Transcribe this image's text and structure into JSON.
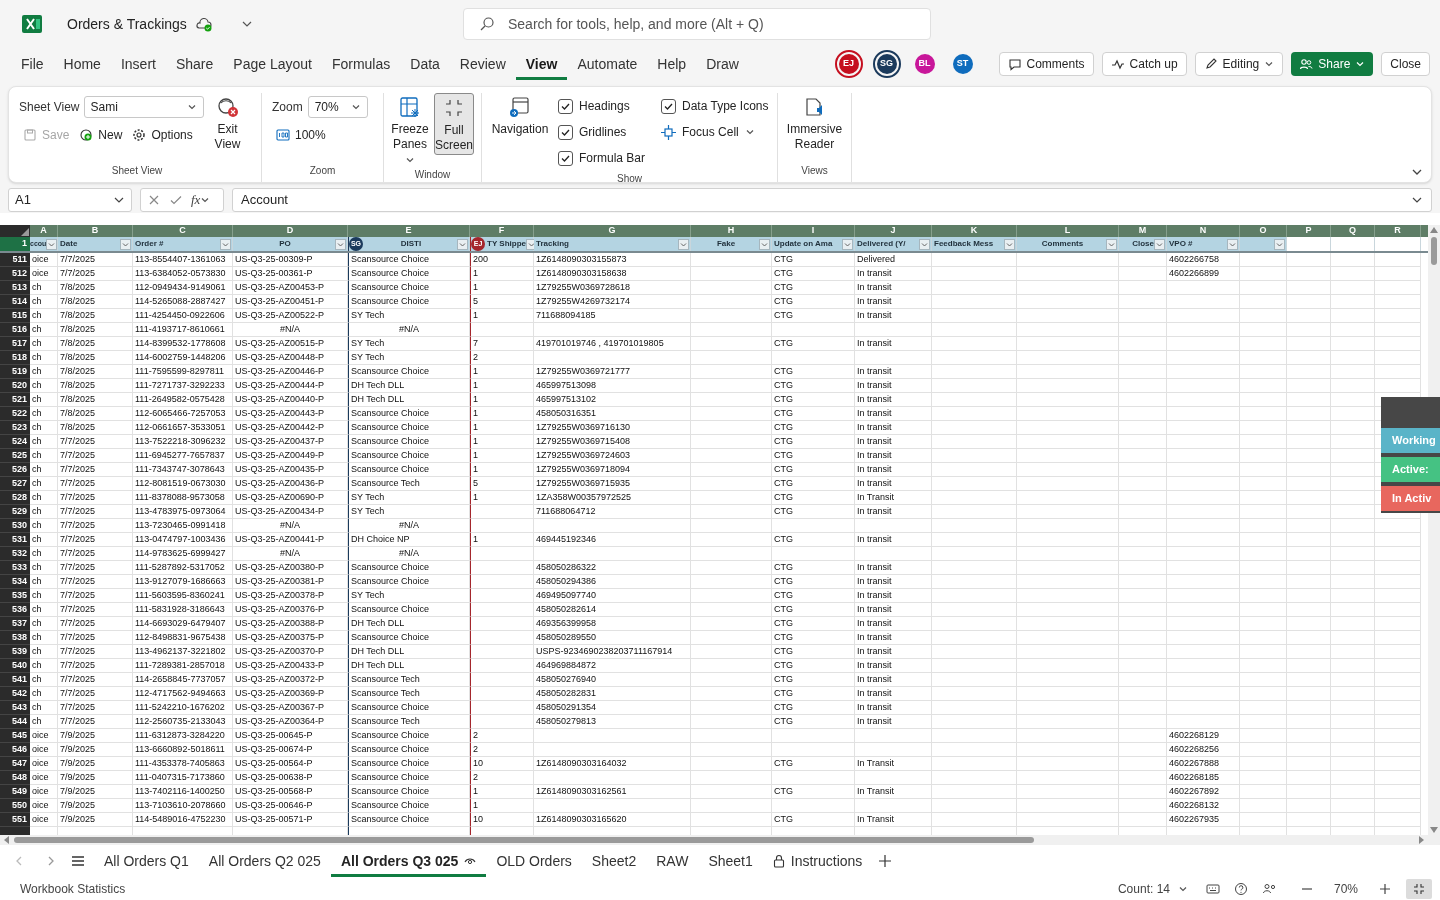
{
  "app": {
    "title": "Orders & Trackings",
    "search_placeholder": "Search for tools, help, and more (Alt + Q)"
  },
  "menu_tabs": [
    {
      "label": "File",
      "selected": false
    },
    {
      "label": "Home",
      "selected": false
    },
    {
      "label": "Insert",
      "selected": false
    },
    {
      "label": "Share",
      "selected": false
    },
    {
      "label": "Page Layout",
      "selected": false
    },
    {
      "label": "Formulas",
      "selected": false
    },
    {
      "label": "Data",
      "selected": false
    },
    {
      "label": "Review",
      "selected": false
    },
    {
      "label": "View",
      "selected": true
    },
    {
      "label": "Automate",
      "selected": false
    },
    {
      "label": "Help",
      "selected": false
    },
    {
      "label": "Draw",
      "selected": false
    }
  ],
  "collaborators": [
    {
      "initials": "EJ",
      "color": "#c50f1f",
      "active": true
    },
    {
      "initials": "SG",
      "color": "#1b3a5c",
      "active": true
    },
    {
      "initials": "BL",
      "color": "#c8179a",
      "active": false
    },
    {
      "initials": "ST",
      "color": "#0f6cbd",
      "active": false
    }
  ],
  "header_buttons": [
    {
      "label": "Comments",
      "kind": "comments"
    },
    {
      "label": "Catch up",
      "kind": "catch-up"
    },
    {
      "label": "Editing",
      "kind": "editing"
    },
    {
      "label": "Share",
      "kind": "share"
    },
    {
      "label": "Close",
      "kind": "close"
    }
  ],
  "ribbon": {
    "groups": [
      {
        "kind": "sheet-view",
        "label": "Sheet View",
        "field_label": "Sheet View",
        "value": "Sami",
        "save": {
          "label": "Save",
          "disabled": true
        },
        "new": "New",
        "options": "Options",
        "exit": "Exit View"
      },
      {
        "kind": "zoom",
        "label": "Zoom",
        "field_label": "Zoom",
        "value": "70%",
        "reset": "100%"
      },
      {
        "kind": "window",
        "label": "Window",
        "freeze": "Freeze Panes",
        "full_screen": {
          "label": "Full Screen",
          "selected": true
        }
      },
      {
        "kind": "show",
        "label": "Show",
        "navigation": "Navigation",
        "checks": [
          {
            "label": "Headings",
            "checked": true
          },
          {
            "label": "Gridlines",
            "checked": true
          },
          {
            "label": "Formula Bar",
            "checked": true
          },
          {
            "label": "Data Type Icons",
            "checked": true
          }
        ],
        "focus_cell": "Focus Cell"
      },
      {
        "kind": "views",
        "label": "Views",
        "reader": "Immersive Reader"
      }
    ]
  },
  "formula_bar": {
    "name_box": "A1",
    "function_symbol": "fx",
    "content": "Account"
  },
  "grid": {
    "column_letters": [
      "A",
      "B",
      "C",
      "D",
      "E",
      "F",
      "G",
      "H",
      "I",
      "J",
      "K",
      "L",
      "M",
      "N",
      "O",
      "P",
      "Q",
      "R"
    ],
    "header_row_number": "1",
    "headers": [
      {
        "label": "ccou"
      },
      {
        "label": "Date"
      },
      {
        "label": "Order #"
      },
      {
        "label": "PO"
      },
      {
        "label": "DISTI",
        "marker": {
          "initials": "SG",
          "color": "#1b3a5c"
        }
      },
      {
        "label": "TY Shippe",
        "marker": {
          "initials": "EJ",
          "color": "#a4262c"
        }
      },
      {
        "label": "Tracking"
      },
      {
        "label": "Fake"
      },
      {
        "label": "Update on Ama"
      },
      {
        "label": "Delivered (Y/"
      },
      {
        "label": "Feedback Mess"
      },
      {
        "label": "Comments"
      },
      {
        "label": "Close"
      },
      {
        "label": "VPO #"
      }
    ],
    "rows": [
      {
        "n": "511",
        "account": "oice",
        "date": "7/7/2025",
        "order": "113-8554407-1361063",
        "po": "US-Q3-25-00309-P",
        "disti": "Scansource Choice",
        "qty": "200",
        "tracking": "1Z6148090303155873",
        "update": "CTG",
        "delivered": "Delivered",
        "vpo": "4602266758"
      },
      {
        "n": "512",
        "account": "oice",
        "date": "7/7/2025",
        "order": "113-6384052-0573830",
        "po": "US-Q3-25-00361-P",
        "disti": "Scansource Choice",
        "qty": "1",
        "tracking": "1Z6148090303158638",
        "update": "CTG",
        "delivered": "In transit",
        "vpo": "4602266899"
      },
      {
        "n": "513",
        "account": "ch",
        "date": "7/8/2025",
        "order": "112-0949434-9149061",
        "po": "US-Q3-25-AZ00453-P",
        "disti": "Scansource Choice",
        "qty": "1",
        "tracking": "1Z79255W0369728618",
        "update": "CTG",
        "delivered": "In transit"
      },
      {
        "n": "514",
        "account": "ch",
        "date": "7/8/2025",
        "order": "114-5265088-2887427",
        "po": "US-Q3-25-AZ00451-P",
        "disti": "Scansource Choice",
        "qty": "5",
        "tracking": "1Z79255W4269732174",
        "update": "CTG",
        "delivered": "In transit"
      },
      {
        "n": "515",
        "account": "ch",
        "date": "7/8/2025",
        "order": "111-4254450-0922606",
        "po": "US-Q3-25-AZ00522-P",
        "disti": "SY Tech",
        "qty": "1",
        "tracking": "711688094185",
        "update": "CTG",
        "delivered": "In transit"
      },
      {
        "n": "516",
        "account": "ch",
        "date": "7/8/2025",
        "order": "111-4193717-8610661",
        "po": "#N/A",
        "disti": "#N/A",
        "error": true
      },
      {
        "n": "517",
        "account": "ch",
        "date": "7/8/2025",
        "order": "114-8399532-1778608",
        "po": "US-Q3-25-AZ00515-P",
        "disti": "SY Tech",
        "qty": "7",
        "tracking": "419701019746 , 419701019805",
        "update": "CTG",
        "delivered": "In transit"
      },
      {
        "n": "518",
        "account": "ch",
        "date": "7/8/2025",
        "order": "114-6002759-1448206",
        "po": "US-Q3-25-AZ00448-P",
        "disti": "SY Tech",
        "qty": "2"
      },
      {
        "n": "519",
        "account": "ch",
        "date": "7/8/2025",
        "order": "111-7595599-8297811",
        "po": "US-Q3-25-AZ00446-P",
        "disti": "Scansource Choice",
        "qty": "1",
        "tracking": "1Z79255W0369721777",
        "update": "CTG",
        "delivered": "In transit"
      },
      {
        "n": "520",
        "account": "ch",
        "date": "7/8/2025",
        "order": "111-7271737-3292233",
        "po": "US-Q3-25-AZ00444-P",
        "disti": "DH Tech DLL",
        "qty": "1",
        "tracking": "465997513098",
        "update": "CTG",
        "delivered": "In transit"
      },
      {
        "n": "521",
        "account": "ch",
        "date": "7/8/2025",
        "order": "111-2649582-0575428",
        "po": "US-Q3-25-AZ00440-P",
        "disti": "DH Tech DLL",
        "qty": "1",
        "tracking": "465997513102",
        "update": "CTG",
        "delivered": "In transit"
      },
      {
        "n": "522",
        "account": "ch",
        "date": "7/8/2025",
        "order": "112-6065466-7257053",
        "po": "US-Q3-25-AZ00443-P",
        "disti": "Scansource Choice",
        "qty": "1",
        "tracking": "458050316351",
        "update": "CTG",
        "delivered": "In transit"
      },
      {
        "n": "523",
        "account": "ch",
        "date": "7/8/2025",
        "order": "112-0661657-3533051",
        "po": "US-Q3-25-AZ00442-P",
        "disti": "Scansource Choice",
        "qty": "1",
        "tracking": "1Z79255W0369716130",
        "update": "CTG",
        "delivered": "In transit"
      },
      {
        "n": "524",
        "account": "ch",
        "date": "7/7/2025",
        "order": "113-7522218-3096232",
        "po": "US-Q3-25-AZ00437-P",
        "disti": "Scansource Choice",
        "qty": "1",
        "tracking": "1Z79255W0369715408",
        "update": "CTG",
        "delivered": "In transit"
      },
      {
        "n": "525",
        "account": "ch",
        "date": "7/7/2025",
        "order": "111-6945277-7657837",
        "po": "US-Q3-25-AZ00449-P",
        "disti": "Scansource Choice",
        "qty": "1",
        "tracking": "1Z79255W0369724603",
        "update": "CTG",
        "delivered": "In transit"
      },
      {
        "n": "526",
        "account": "ch",
        "date": "7/7/2025",
        "order": "111-7343747-3078643",
        "po": "US-Q3-25-AZ00435-P",
        "disti": "Scansource Choice",
        "qty": "1",
        "tracking": "1Z79255W0369718094",
        "update": "CTG",
        "delivered": "In transit"
      },
      {
        "n": "527",
        "account": "ch",
        "date": "7/7/2025",
        "order": "112-8081519-0673030",
        "po": "US-Q3-25-AZ00436-P",
        "disti": "Scansource Tech",
        "qty": "5",
        "tracking": "1Z79255W0369715935",
        "update": "CTG",
        "delivered": "In transit"
      },
      {
        "n": "528",
        "account": "ch",
        "date": "7/7/2025",
        "order": "111-8378088-9573058",
        "po": "US-Q3-25-AZ00690-P",
        "disti": "SY Tech",
        "qty": "1",
        "tracking": "1ZA358W00357972525",
        "update": "CTG",
        "delivered": "In Transit"
      },
      {
        "n": "529",
        "account": "ch",
        "date": "7/7/2025",
        "order": "113-4783975-0973064",
        "po": "US-Q3-25-AZ00434-P",
        "disti": "SY Tech",
        "tracking": "711688064712",
        "update": "CTG",
        "delivered": "In transit"
      },
      {
        "n": "530",
        "account": "ch",
        "date": "7/7/2025",
        "order": "113-7230465-0991418",
        "po": "#N/A",
        "disti": "#N/A",
        "error": true
      },
      {
        "n": "531",
        "account": "ch",
        "date": "7/7/2025",
        "order": "113-0474797-1003436",
        "po": "US-Q3-25-AZ00441-P",
        "disti": "DH Choice NP",
        "qty": "1",
        "tracking": "469445192346",
        "update": "CTG",
        "delivered": "In transit"
      },
      {
        "n": "532",
        "account": "ch",
        "date": "7/7/2025",
        "order": "114-9783625-6999427",
        "po": "#N/A",
        "disti": "#N/A",
        "error": true
      },
      {
        "n": "533",
        "account": "ch",
        "date": "7/7/2025",
        "order": "111-5287892-5317052",
        "po": "US-Q3-25-AZ00380-P",
        "disti": "Scansource Choice",
        "tracking": "458050286322",
        "update": "CTG",
        "delivered": "In transit"
      },
      {
        "n": "534",
        "account": "ch",
        "date": "7/7/2025",
        "order": "113-9127079-1686663",
        "po": "US-Q3-25-AZ00381-P",
        "disti": "Scansource Choice",
        "tracking": "458050294386",
        "update": "CTG",
        "delivered": "In transit"
      },
      {
        "n": "535",
        "account": "ch",
        "date": "7/7/2025",
        "order": "111-5603595-8360241",
        "po": "US-Q3-25-AZ00378-P",
        "disti": "SY Tech",
        "tracking": "469495097740",
        "update": "CTG",
        "delivered": "In transit"
      },
      {
        "n": "536",
        "account": "ch",
        "date": "7/7/2025",
        "order": "111-5831928-3186643",
        "po": "US-Q3-25-AZ00376-P",
        "disti": "Scansource Choice",
        "tracking": "458050282614",
        "update": "CTG",
        "delivered": "In transit"
      },
      {
        "n": "537",
        "account": "ch",
        "date": "7/7/2025",
        "order": "114-6693029-6479407",
        "po": "US-Q3-25-AZ00388-P",
        "disti": "DH Tech DLL",
        "tracking": "469356399958",
        "update": "CTG",
        "delivered": "In transit"
      },
      {
        "n": "538",
        "account": "ch",
        "date": "7/7/2025",
        "order": "112-8498831-9675438",
        "po": "US-Q3-25-AZ00375-P",
        "disti": "Scansource Choice",
        "tracking": "458050289550",
        "update": "CTG",
        "delivered": "In transit"
      },
      {
        "n": "539",
        "account": "ch",
        "date": "7/7/2025",
        "order": "113-4962137-3221802",
        "po": "US-Q3-25-AZ00370-P",
        "disti": "DH Tech DLL",
        "tracking": "USPS-9234690238203711167914",
        "update": "CTG",
        "delivered": "In transit"
      },
      {
        "n": "540",
        "account": "ch",
        "date": "7/7/2025",
        "order": "111-7289381-2857018",
        "po": "US-Q3-25-AZ00433-P",
        "disti": "DH Tech DLL",
        "tracking": "464969884872",
        "update": "CTG",
        "delivered": "In transit"
      },
      {
        "n": "541",
        "account": "ch",
        "date": "7/7/2025",
        "order": "114-2658845-7737057",
        "po": "US-Q3-25-AZ00372-P",
        "disti": "Scansource Tech",
        "tracking": "458050276940",
        "update": "CTG",
        "delivered": "In transit"
      },
      {
        "n": "542",
        "account": "ch",
        "date": "7/7/2025",
        "order": "112-4717562-9494663",
        "po": "US-Q3-25-AZ00369-P",
        "disti": "Scansource Tech",
        "tracking": "458050282831",
        "update": "CTG",
        "delivered": "In transit"
      },
      {
        "n": "543",
        "account": "ch",
        "date": "7/7/2025",
        "order": "111-5242210-1676202",
        "po": "US-Q3-25-AZ00367-P",
        "disti": "Scansource Choice",
        "tracking": "458050291354",
        "update": "CTG",
        "delivered": "In transit"
      },
      {
        "n": "544",
        "account": "ch",
        "date": "7/7/2025",
        "order": "112-2560735-2133043",
        "po": "US-Q3-25-AZ00364-P",
        "disti": "Scansource Tech",
        "tracking": "458050279813",
        "update": "CTG",
        "delivered": "In transit"
      },
      {
        "n": "545",
        "account": "oice",
        "date": "7/9/2025",
        "order": "111-6312873-3284220",
        "po": "US-Q3-25-00645-P",
        "disti": "Scansource Choice",
        "qty": "2",
        "vpo": "4602268129"
      },
      {
        "n": "546",
        "account": "oice",
        "date": "7/9/2025",
        "order": "113-6660892-5018611",
        "po": "US-Q3-25-00674-P",
        "disti": "Scansource Choice",
        "qty": "2",
        "vpo": "4602268256"
      },
      {
        "n": "547",
        "account": "oice",
        "date": "7/9/2025",
        "order": "111-4353378-7405863",
        "po": "US-Q3-25-00564-P",
        "disti": "Scansource Choice",
        "qty": "10",
        "tracking": "1Z6148090303164032",
        "update": "CTG",
        "delivered": "In Transit",
        "vpo": "4602267888"
      },
      {
        "n": "548",
        "account": "oice",
        "date": "7/9/2025",
        "order": "111-0407315-7173860",
        "po": "US-Q3-25-00638-P",
        "disti": "Scansource Choice",
        "qty": "2",
        "vpo": "4602268185"
      },
      {
        "n": "549",
        "account": "oice",
        "date": "7/9/2025",
        "order": "113-7402116-1400250",
        "po": "US-Q3-25-00568-P",
        "disti": "Scansource Choice",
        "qty": "1",
        "tracking": "1Z6148090303162561",
        "update": "CTG",
        "delivered": "In Transit",
        "vpo": "4602267892"
      },
      {
        "n": "550",
        "account": "oice",
        "date": "7/9/2025",
        "order": "113-7103610-2078660",
        "po": "US-Q3-25-00646-P",
        "disti": "Scansource Choice",
        "qty": "1",
        "vpo": "4602268132"
      },
      {
        "n": "551",
        "account": "oice",
        "date": "7/9/2025",
        "order": "114-5489016-4752230",
        "po": "US-Q3-25-00571-P",
        "disti": "Scansource Choice",
        "qty": "10",
        "tracking": "1Z6148090303165620",
        "update": "CTG",
        "delivered": "In Transit",
        "vpo": "4602267935"
      }
    ]
  },
  "status_panel": [
    {
      "label": "Working",
      "color": "#5ab4c8"
    },
    {
      "label": "Active:",
      "color": "#45c283"
    },
    {
      "label": "In Activ",
      "color": "#e8675e"
    }
  ],
  "sheet_tabs": [
    {
      "label": "All Orders Q1",
      "selected": false,
      "locked": false
    },
    {
      "label": "All Orders Q2 025",
      "selected": false,
      "locked": false
    },
    {
      "label": "All Orders Q3 025",
      "selected": true,
      "locked": false
    },
    {
      "label": "OLD Orders",
      "selected": false,
      "locked": false
    },
    {
      "label": "Sheet2",
      "selected": false,
      "locked": false
    },
    {
      "label": "RAW",
      "selected": false,
      "locked": false
    },
    {
      "label": "Sheet1",
      "selected": false,
      "locked": false
    },
    {
      "label": "Instructions",
      "selected": false,
      "locked": true
    }
  ],
  "status_bar": {
    "left": "Workbook Statistics",
    "count": "Count: 14",
    "zoom": "70%"
  }
}
